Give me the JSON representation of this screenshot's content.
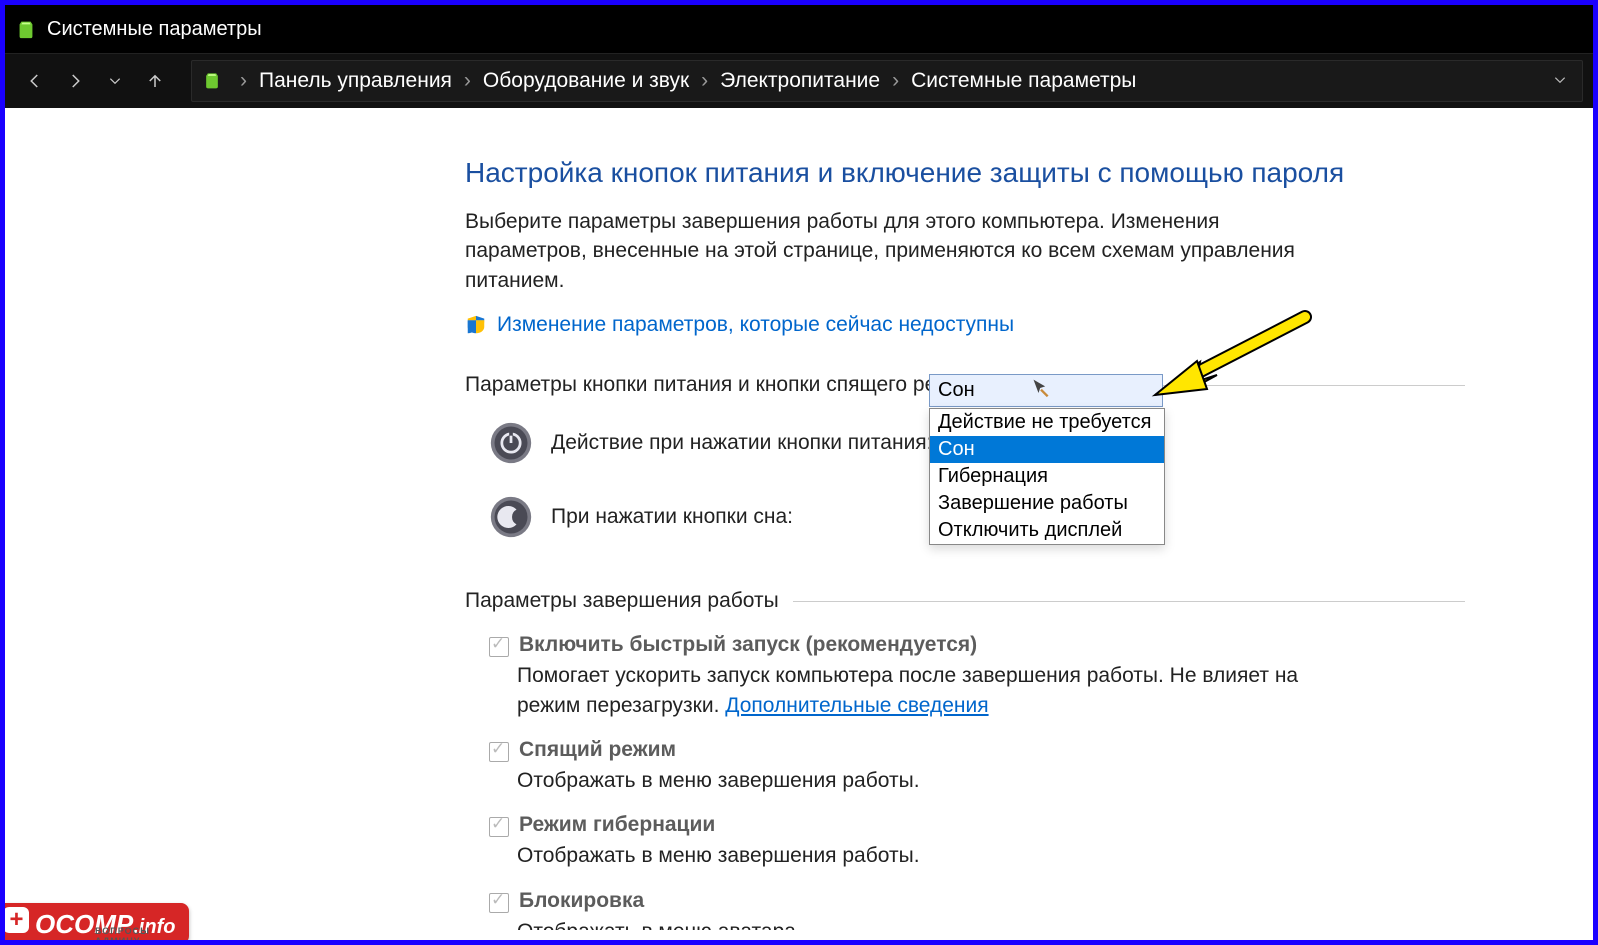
{
  "window": {
    "title": "Системные параметры"
  },
  "breadcrumbs": {
    "item0": "Панель управления",
    "item1": "Оборудование и звук",
    "item2": "Электропитание",
    "item3": "Системные параметры"
  },
  "page": {
    "heading": "Настройка кнопок питания и включение защиты с помощью пароля",
    "description": "Выберите параметры завершения работы для этого компьютера. Изменения параметров, внесенные на этой странице, применяются ко всем схемам управления питанием.",
    "change_unavailable_link": "Изменение параметров, которые сейчас недоступны"
  },
  "sections": {
    "power_sleep_title": "Параметры кнопки питания и кнопки спящего режима",
    "power_button_label": "Действие при нажатии кнопки питания:",
    "sleep_button_label": "При нажатии кнопки сна:",
    "shutdown_title": "Параметры завершения работы"
  },
  "dropdown": {
    "selected": "Сон",
    "options": {
      "o0": "Действие не требуется",
      "o1": "Сон",
      "o2": "Гибернация",
      "o3": "Завершение работы",
      "o4": "Отключить дисплей"
    }
  },
  "shutdown_options": {
    "fast_startup": {
      "label": "Включить быстрый запуск (рекомендуется)",
      "desc_prefix": "Помогает ускорить запуск компьютера после завершения работы. Не влияет на режим перезагрузки. ",
      "more_info": "Дополнительные сведения"
    },
    "sleep": {
      "label": "Спящий режим",
      "desc": "Отображать в меню завершения работы."
    },
    "hibernate": {
      "label": "Режим гибернации",
      "desc": "Отображать в меню завершения работы."
    },
    "lock": {
      "label": "Блокировка",
      "desc": "Отображать в меню аватара."
    }
  },
  "watermark": {
    "main": "OCOMP",
    "suffix": ".info",
    "sub": "ВОПРОСЫ АДМИНУ"
  }
}
